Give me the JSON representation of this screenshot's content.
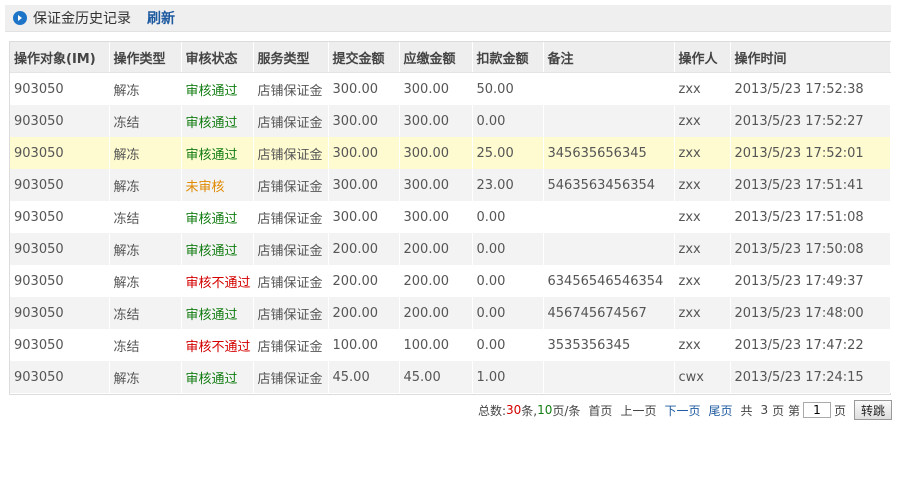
{
  "header": {
    "title": "保证金历史记录",
    "refresh": "刷新",
    "icon": "arrow-circle-icon"
  },
  "colors": {
    "ok": "#137d13",
    "pending": "#e08a00",
    "fail": "#d40000",
    "link": "#1e5aa0",
    "highlight_row": "#fefbd0"
  },
  "table": {
    "columns": [
      "操作对象(IM)",
      "操作类型",
      "审核状态",
      "服务类型",
      "提交金额",
      "应缴金额",
      "扣款金额",
      "备注",
      "操作人",
      "操作时间"
    ],
    "rows": [
      {
        "target": "903050",
        "op": "解冻",
        "status": "审核通过",
        "status_type": "ok",
        "service": "店铺保证金",
        "submit": "300.00",
        "due": "300.00",
        "deduct": "50.00",
        "note": "",
        "operator": "zxx",
        "time": "2013/5/23 17:52:38"
      },
      {
        "target": "903050",
        "op": "冻结",
        "status": "审核通过",
        "status_type": "ok",
        "service": "店铺保证金",
        "submit": "300.00",
        "due": "300.00",
        "deduct": "0.00",
        "note": "",
        "operator": "zxx",
        "time": "2013/5/23 17:52:27"
      },
      {
        "target": "903050",
        "op": "解冻",
        "status": "审核通过",
        "status_type": "ok",
        "service": "店铺保证金",
        "submit": "300.00",
        "due": "300.00",
        "deduct": "25.00",
        "note": "345635656345",
        "operator": "zxx",
        "time": "2013/5/23 17:52:01"
      },
      {
        "target": "903050",
        "op": "解冻",
        "status": "未审核",
        "status_type": "pending",
        "service": "店铺保证金",
        "submit": "300.00",
        "due": "300.00",
        "deduct": "23.00",
        "note": "5463563456354",
        "operator": "zxx",
        "time": "2013/5/23 17:51:41"
      },
      {
        "target": "903050",
        "op": "冻结",
        "status": "审核通过",
        "status_type": "ok",
        "service": "店铺保证金",
        "submit": "300.00",
        "due": "300.00",
        "deduct": "0.00",
        "note": "",
        "operator": "zxx",
        "time": "2013/5/23 17:51:08"
      },
      {
        "target": "903050",
        "op": "解冻",
        "status": "审核通过",
        "status_type": "ok",
        "service": "店铺保证金",
        "submit": "200.00",
        "due": "200.00",
        "deduct": "0.00",
        "note": "",
        "operator": "zxx",
        "time": "2013/5/23 17:50:08"
      },
      {
        "target": "903050",
        "op": "解冻",
        "status": "审核不通过",
        "status_type": "fail",
        "service": "店铺保证金",
        "submit": "200.00",
        "due": "200.00",
        "deduct": "0.00",
        "note": "63456546546354",
        "operator": "zxx",
        "time": "2013/5/23 17:49:37"
      },
      {
        "target": "903050",
        "op": "冻结",
        "status": "审核通过",
        "status_type": "ok",
        "service": "店铺保证金",
        "submit": "200.00",
        "due": "200.00",
        "deduct": "0.00",
        "note": "456745674567",
        "operator": "zxx",
        "time": "2013/5/23 17:48:00"
      },
      {
        "target": "903050",
        "op": "冻结",
        "status": "审核不通过",
        "status_type": "fail",
        "service": "店铺保证金",
        "submit": "100.00",
        "due": "100.00",
        "deduct": "0.00",
        "note": "3535356345",
        "operator": "zxx",
        "time": "2013/5/23 17:47:22"
      },
      {
        "target": "903050",
        "op": "解冻",
        "status": "审核通过",
        "status_type": "ok",
        "service": "店铺保证金",
        "submit": "45.00",
        "due": "45.00",
        "deduct": "1.00",
        "note": "",
        "operator": "cwx",
        "time": "2013/5/23 17:24:15"
      }
    ],
    "highlighted_row": 2
  },
  "pager": {
    "total_label": "总数:",
    "total": "30",
    "total_unit": "条,",
    "page_size": "10",
    "page_size_unit": "页/条",
    "first": "首页",
    "prev": "上一页",
    "next": "下一页",
    "last": "尾页",
    "total_pages_prefix": "共",
    "total_pages": "3",
    "total_pages_suffix": "页 第",
    "current_page": "1",
    "page_suffix": "页",
    "go": "转跳"
  }
}
